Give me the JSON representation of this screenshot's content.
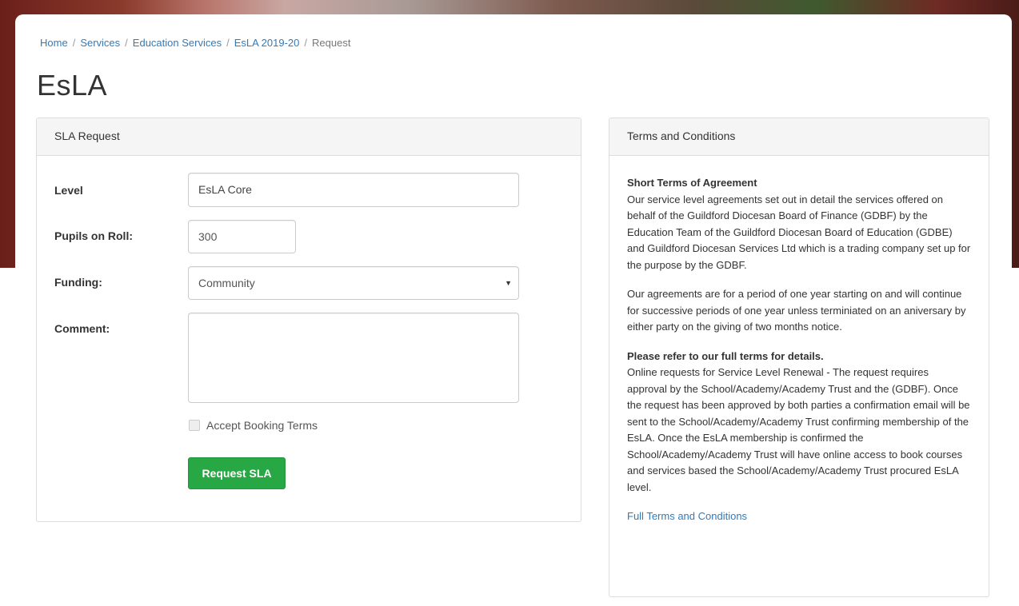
{
  "breadcrumb": {
    "items": [
      "Home",
      "Services",
      "Education Services",
      "EsLA 2019-20"
    ],
    "current": "Request"
  },
  "page_title": "EsLA",
  "sla_panel": {
    "heading": "SLA Request",
    "level": {
      "label": "Level",
      "value": "EsLA Core"
    },
    "pupils": {
      "label": "Pupils on Roll:",
      "value": "300"
    },
    "funding": {
      "label": "Funding:",
      "value": "Community"
    },
    "comment": {
      "label": "Comment:",
      "value": ""
    },
    "accept_label": "Accept Booking Terms",
    "submit_label": "Request SLA"
  },
  "terms_panel": {
    "heading": "Terms and Conditions",
    "short_title": "Short Terms of Agreement",
    "para1": "Our service level agreements set out in detail the services offered on behalf of the Guildford Diocesan Board of Finance (GDBF) by the Education Team of the Guildford Diocesan Board of Education (GDBE) and Guildford Diocesan Services Ltd which is a trading company set up for the purpose by the GDBF.",
    "para2": "Our agreements are for a period of one year starting on and will continue for successive periods of one year unless terminiated on an aniversary by either party on the giving of two months notice.",
    "refer_title": "Please refer to our full terms for details.",
    "para3": "Online requests for Service Level Renewal - The request requires approval by the School/Academy/Academy Trust and the (GDBF). Once the request has been approved by both parties a confirmation email will be sent to the School/Academy/Academy Trust confirming membership of the EsLA. Once the EsLA membership is confirmed the School/Academy/Academy Trust will have online access to book courses and services based the School/Academy/Academy Trust procured EsLA level.",
    "full_terms_link": "Full Terms and Conditions"
  },
  "colors": {
    "link": "#337ab7",
    "submit_button": "#28a745"
  }
}
